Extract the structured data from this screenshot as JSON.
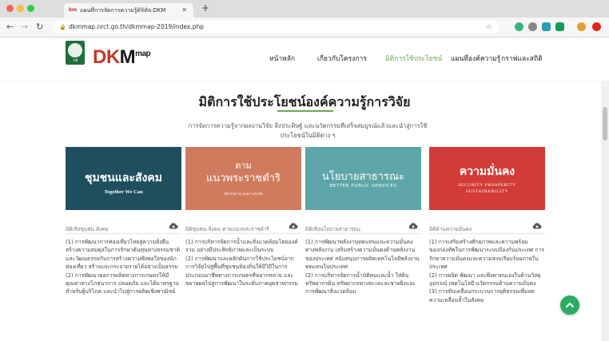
{
  "browser": {
    "tab_title": "แผนที่การจัดการความรู้ดิจิทัล:DKM",
    "tab_favicon": "km",
    "url": "dkmmap.nrct.go.th/dkmmap-2019/index.php"
  },
  "site": {
    "logo_emblem_text": "วช",
    "logo_dk": "DK",
    "logo_m": "M",
    "logo_map": "map",
    "nav": [
      {
        "label": "หน้าหลัก"
      },
      {
        "label": "เกี่ยวกับโครงการ"
      },
      {
        "label": "มิติการใช้ประโยชน์"
      },
      {
        "label": "แผนที่องค์ความรู้"
      },
      {
        "label": "กราฟและสถิติ"
      }
    ],
    "accent_color": "#6aa84f"
  },
  "section": {
    "title": "มิติการใช้ประโยชน์องค์ความรู้การวิจัย",
    "lead": "การจัดการความรู้จากผลงานวิจัย สิ่งประดิษฐ์ และนวัตกรรมที่เสร็จสมบูรณ์แล้วและนำสู่การใช้ประโยชน์ในมิติต่าง ๆ"
  },
  "cards": [
    {
      "color": "#1f4f5f",
      "banner_title": "ชุมชนและสังคม",
      "banner_sub": "Together We Can",
      "category": "มิติเชิงชุมชน สังคม",
      "description": "(1) การพัฒนาการท่องเที่ยวไทยสู่ความยั่งยืน สร้างความสมดุลในการรักษาต้นทุนทางธรรมชาติและวัฒนธรรมกับการสร้างความพึงพอใจของนักท่องเที่ยว สร้างและกระจายรายได้อย่างเป็นธรรม\n(2) การพัฒนาผลการผลิตทางการเกษตรให้มีคุณค่าทางโภชนาการ ปลอดภัย และได้มาตรฐานสำหรับผู้บริโภค และนำไปสู่การผลิตเชิงพาณิชย์"
    },
    {
      "color": "#d17b5e",
      "banner_top": "ตาม",
      "banner_title": "แนวพระราชดำริ",
      "banner_sub": "Be true to your words",
      "category": "มิติชุมชน-สังคม ตามแนวพระราชดำริ",
      "description": "(1) การบริหารจัดการน้ำและสิ่งแวดล้อมโดยองค์รวม อย่างมีประสิทธิภาพและเป็นระบบ\n(2) การพัฒนาและผลักดันการใช้ประโยชน์จากการวิจัยไปสู่พื้นที่ชุมชนท้องถิ่นให้มีวิถีในการประกอบอาชีพทางการเกษตรที่หลากหลาย และขยายผลไปสู่การพัฒนาในระดับภาคอุตสาหกรรม"
    },
    {
      "color": "#5ea6a8",
      "banner_title": "นโยบายสาธารณะ",
      "banner_sub": "BETTER PUBLIC SERVICES",
      "category": "มิติเชิงนโยบายสาธารณะ",
      "description": "(1) การพัฒนาพลังงานทดแทนและความมั่นคงทางพลังงาน เสริมสร้างความมั่นคงด้านพลังงานของประเทศ สนับสนุนการผลิตเทคโนโลยีพลังงานทดแทนในประเทศ\n(2) การบริหารจัดการน้ำมิติคนและน้ำ ใส่ต้นทรัพยากรดิน ทรัพยากรทางทะเลและชายฝั่งและการพัฒนาสิ่งแวดล้อม"
    },
    {
      "color": "#d23b36",
      "banner_title": "ความมั่นคง",
      "banner_sub": "SECURITY  PROSPERITY  SUSTAINABILITY",
      "category": "มิติด้านความมั่นคง",
      "description": "(1) การเสริมสร้างศักยภาพและความพร้อมของกองทัพในการพัฒนาระบบป้องกันประเทศ การรักษาความมั่นคงและความสงบเรียบร้อยภายในประเทศ\n(2) การผลิต พัฒนา และพึ่งพาตนเองในด้านวัสดุ อุปกรณ์ เทคโนโลยี นวัตกรรมด้านความมั่นคง\n(3) การขับเคลื่อนกระบวนการยุติธรรมเพื่อลดความเหลื่อมล้ำในสังคม"
    }
  ],
  "icons": {
    "download": "cloud-download-icon",
    "back_to_top": "chevron-up-icon"
  }
}
